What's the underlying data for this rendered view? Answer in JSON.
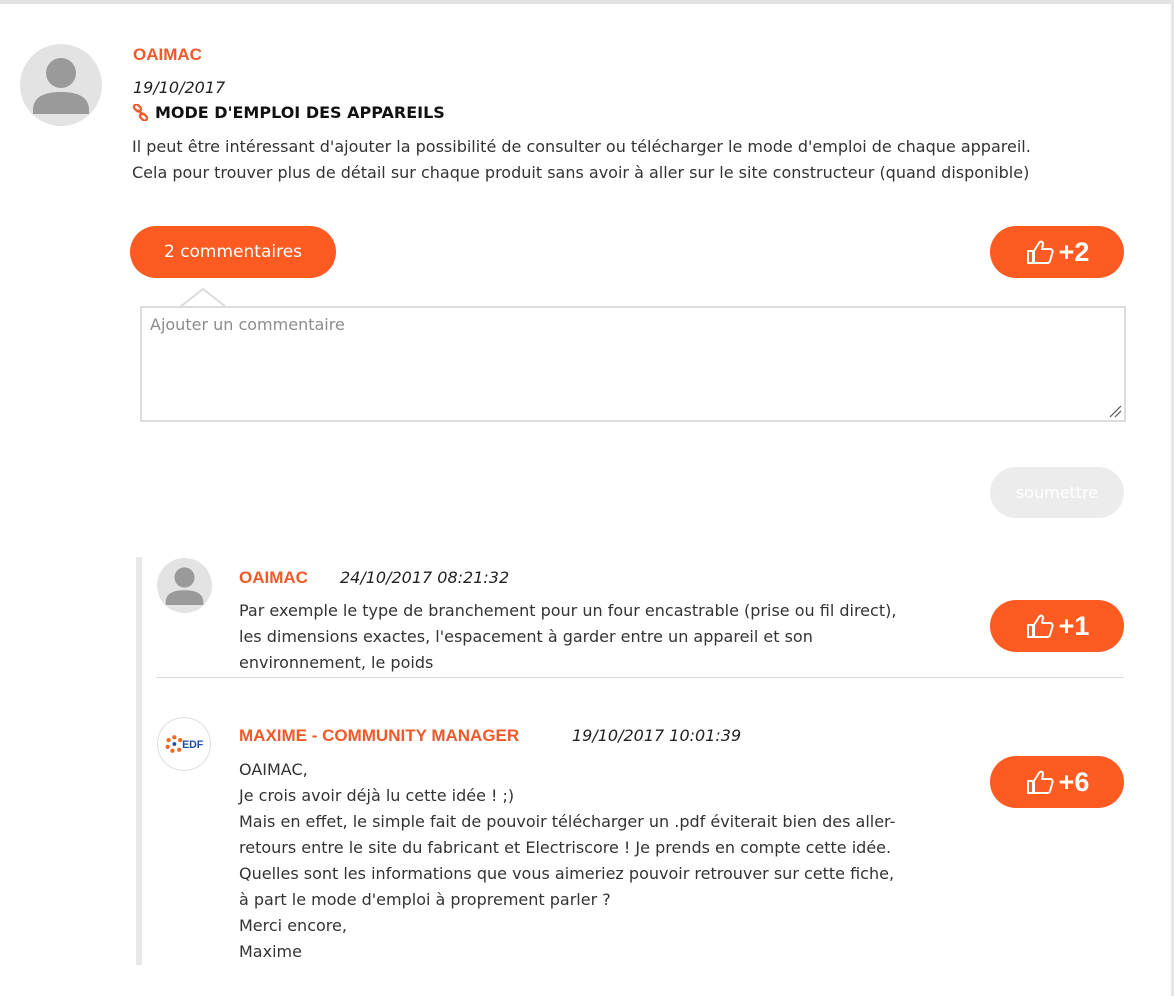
{
  "idea": {
    "author": "OAIMAC",
    "date": "19/10/2017",
    "title": "MODE D'EMPLOI DES APPAREILS",
    "body_lines": [
      "Il peut être intéressant d'ajouter la possibilité de consulter ou télécharger le mode d'emploi de chaque appareil.",
      "Cela pour trouver plus de détail sur chaque produit sans avoir à aller sur le site constructeur (quand disponible)"
    ],
    "comments_button": "2 commentaires",
    "vote_label": "+2"
  },
  "comment_form": {
    "placeholder": "Ajouter un commentaire",
    "submit_label": "soumettre"
  },
  "comments": [
    {
      "author": "OAIMAC",
      "datetime": "24/10/2017 08:21:32",
      "lines": [
        "Par exemple le type de branchement pour un four encastrable (prise ou fil direct),",
        "les dimensions exactes, l'espacement à garder entre un appareil et son",
        "environnement, le poids"
      ],
      "vote_label": "+1"
    },
    {
      "author": "MAXIME - COMMUNITY MANAGER",
      "datetime": "19/10/2017 10:01:39",
      "logo_text": "EDF",
      "lines": [
        "OAIMAC,",
        "Je crois avoir déjà lu cette idée ! ;)",
        "Mais en effet, le simple fait de pouvoir télécharger un .pdf éviterait bien des aller-",
        "retours entre le site du fabricant et Electriscore ! Je prends en compte cette idée.",
        "Quelles sont les informations que vous aimeriez pouvoir retrouver sur cette fiche,",
        "à part le mode d'emploi à proprement parler ?",
        "Merci encore,",
        "Maxime"
      ],
      "vote_label": "+6"
    }
  ],
  "icons": {
    "avatar": "user-avatar-icon",
    "link": "link-icon",
    "thumb": "thumbs-up-icon",
    "logo": "edf-logo-icon"
  },
  "colors": {
    "accent": "#fd5b21",
    "author": "#f0592a",
    "submit_disabled": "#ececec",
    "avatar_bg": "#e3e3e3",
    "avatar_fg": "#9a9a9a"
  }
}
